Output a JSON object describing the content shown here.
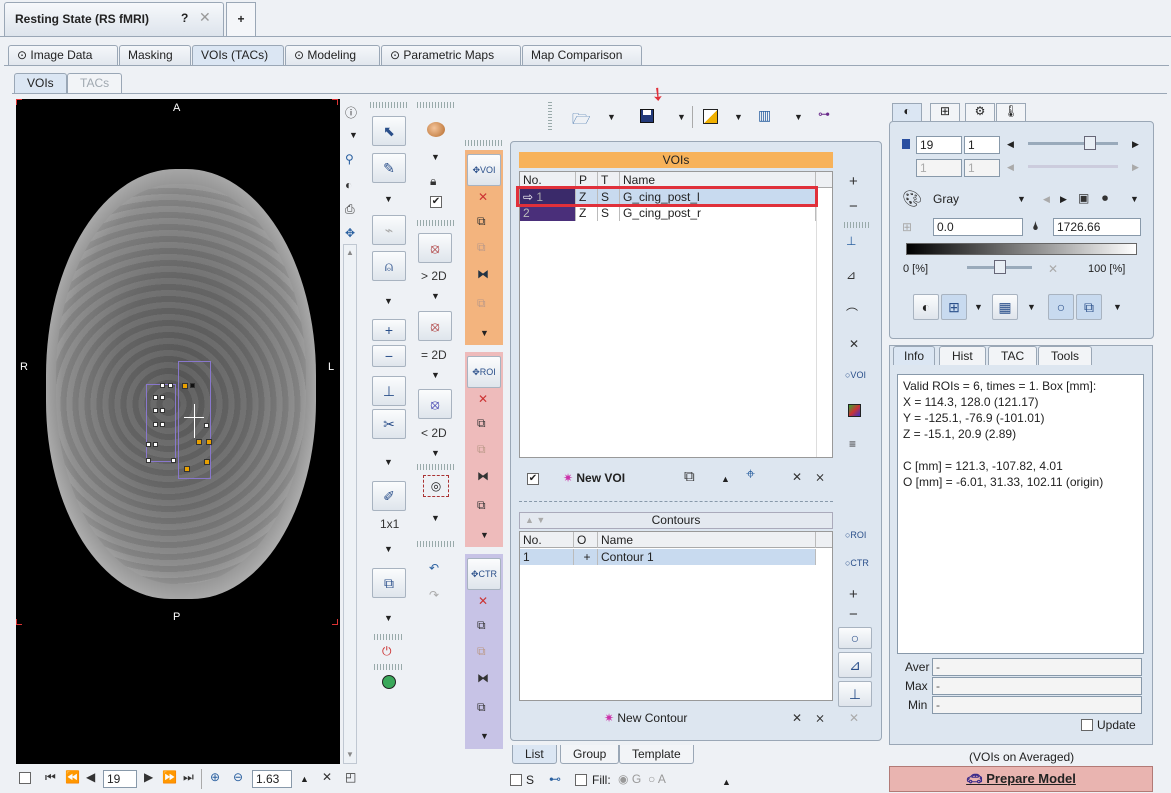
{
  "window_tab": {
    "title": "Resting State (RS fMRI)",
    "help": "?",
    "close": "✕",
    "add": "+"
  },
  "main_tabs": [
    "Image Data",
    "Masking",
    "VOIs (TACs)",
    "Modeling",
    "Parametric Maps",
    "Map Comparison"
  ],
  "sub_tabs": [
    "VOIs",
    "TACs"
  ],
  "viewer": {
    "top": "A",
    "bottom": "P",
    "left": "R",
    "right": "L"
  },
  "tools": {
    "gt2d": "> 2D",
    "eq2d": "= 2D",
    "lt2d": "< 2D",
    "grid": "1x1"
  },
  "vois": {
    "header": "VOIs",
    "columns": [
      "No.",
      "P",
      "T",
      "Name"
    ],
    "rows": [
      {
        "no": "1",
        "p": "Z",
        "t": "S",
        "name": "G_cing_post_l",
        "color": "#3a2a6a"
      },
      {
        "no": "2",
        "p": "Z",
        "t": "S",
        "name": "G_cing_post_r",
        "color": "#4a2f7a"
      }
    ],
    "new_voi": "New VOI"
  },
  "contours": {
    "header": "Contours",
    "columns": [
      "No.",
      "O",
      "Name"
    ],
    "rows": [
      {
        "no": "1",
        "o": "+",
        "name": "Contour 1"
      }
    ],
    "new_contour": "New Contour"
  },
  "bottom_tabs": [
    "List",
    "Group",
    "Template"
  ],
  "bottom_bar": {
    "frame": "19",
    "zoom": "1.63",
    "s_label": "S",
    "fill_label": "Fill:",
    "g_label": "G",
    "a_label": "A"
  },
  "right": {
    "plane": "19",
    "frame": "1",
    "plane2": "1",
    "frame2": "1",
    "colormap": "Gray",
    "min": "0.0",
    "max": "1726.66",
    "pct_min": "0 [%]",
    "pct_max": "100 [%]",
    "info_tabs": [
      "Info",
      "Hist",
      "TAC",
      "Tools"
    ],
    "info_lines": [
      "Valid ROIs = 6, times = 1.  Box [mm]:",
      "X = 114.3, 128.0 (121.17)",
      "Y = -125.1, -76.9 (-101.01)",
      "Z = -15.1, 20.9 (2.89)",
      "",
      "C [mm] = 121.3, -107.82, 4.01",
      "O [mm] = -6.01, 31.33, 102.11 (origin)"
    ],
    "stats": {
      "aver": "Aver",
      "max": "Max",
      "min": "Min",
      "dash": "-"
    },
    "update": "Update",
    "vois_on": "(VOIs on Averaged)",
    "prepare": "Prepare Model"
  },
  "colors": {
    "voi_header": "#f7b25a",
    "roi_strip": "#f3b47e",
    "roi_strip2": "#eebbbb",
    "ctr_strip": "#c7c3e6",
    "highlight": "#c8daef",
    "red": "#e0303a"
  }
}
